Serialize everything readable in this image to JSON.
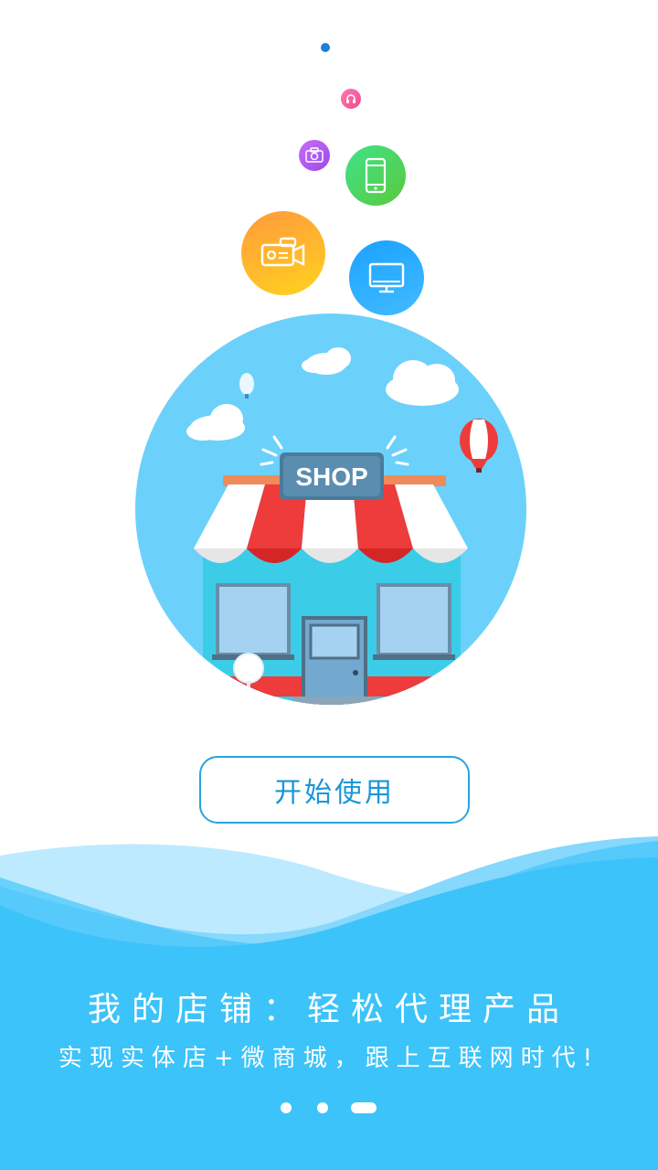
{
  "shop_sign": "SHOP",
  "start_button": "开始使用",
  "headline": "我的店铺：轻松代理产品",
  "subline": "实现实体店+微商城，跟上互联网时代!",
  "icons": [
    "headphones-icon",
    "camera-icon",
    "phone-icon",
    "video-camera-icon",
    "monitor-icon"
  ],
  "pager": {
    "count": 3,
    "active": 3
  },
  "colors": {
    "accent": "#1996d6",
    "wave": "#3cc3fa",
    "sky": "#6bd1fa",
    "awning_red": "#ee3b3b"
  }
}
